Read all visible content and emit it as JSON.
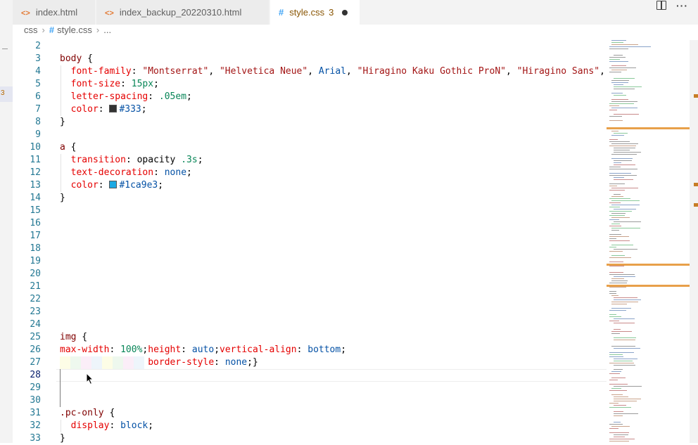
{
  "tabs": [
    {
      "icon": "<>",
      "label": "index.html"
    },
    {
      "icon": "<>",
      "label": "index_backup_20220310.html"
    },
    {
      "icon": "#",
      "label": "style.css",
      "problems": "3"
    }
  ],
  "tab_actions": {
    "more": "···"
  },
  "breadcrumb": {
    "folder": "css",
    "file": "style.css",
    "more": "..."
  },
  "activity_badge": "3",
  "lines": [
    {
      "n": "2"
    },
    {
      "n": "3",
      "tokens": [
        {
          "t": "body",
          "c": "sel"
        },
        {
          "t": " {",
          "c": ""
        }
      ]
    },
    {
      "n": "4",
      "tokens": [
        {
          "t": "  ",
          "c": ""
        },
        {
          "t": "font-family",
          "c": "prop"
        },
        {
          "t": ": ",
          "c": ""
        },
        {
          "t": "\"Montserrat\"",
          "c": "str"
        },
        {
          "t": ", ",
          "c": ""
        },
        {
          "t": "\"Helvetica Neue\"",
          "c": "str"
        },
        {
          "t": ", ",
          "c": ""
        },
        {
          "t": "Arial",
          "c": "val"
        },
        {
          "t": ", ",
          "c": ""
        },
        {
          "t": "\"Hiragino Kaku Gothic ProN\"",
          "c": "str"
        },
        {
          "t": ", ",
          "c": ""
        },
        {
          "t": "\"Hiragino Sans\"",
          "c": "str"
        },
        {
          "t": ", Meiryo,",
          "c": ""
        }
      ]
    },
    {
      "n": "5",
      "tokens": [
        {
          "t": "  ",
          "c": ""
        },
        {
          "t": "font-size",
          "c": "prop"
        },
        {
          "t": ": ",
          "c": ""
        },
        {
          "t": "15px",
          "c": "num"
        },
        {
          "t": ";",
          "c": ""
        }
      ]
    },
    {
      "n": "6",
      "tokens": [
        {
          "t": "  ",
          "c": ""
        },
        {
          "t": "letter-spacing",
          "c": "prop"
        },
        {
          "t": ": ",
          "c": ""
        },
        {
          "t": ".05em",
          "c": "num"
        },
        {
          "t": ";",
          "c": ""
        }
      ]
    },
    {
      "n": "7",
      "tokens": [
        {
          "t": "  ",
          "c": ""
        },
        {
          "t": "color",
          "c": "prop"
        },
        {
          "t": ": ",
          "c": ""
        },
        {
          "t": "",
          "c": "",
          "swatch": "#333333"
        },
        {
          "t": "#333",
          "c": "val"
        },
        {
          "t": ";",
          "c": ""
        }
      ]
    },
    {
      "n": "8",
      "tokens": [
        {
          "t": "}",
          "c": ""
        }
      ]
    },
    {
      "n": "9"
    },
    {
      "n": "10",
      "tokens": [
        {
          "t": "a",
          "c": "sel"
        },
        {
          "t": " {",
          "c": ""
        }
      ]
    },
    {
      "n": "11",
      "tokens": [
        {
          "t": "  ",
          "c": ""
        },
        {
          "t": "transition",
          "c": "prop"
        },
        {
          "t": ": opacity ",
          "c": ""
        },
        {
          "t": ".3s",
          "c": "num"
        },
        {
          "t": ";",
          "c": ""
        }
      ]
    },
    {
      "n": "12",
      "tokens": [
        {
          "t": "  ",
          "c": ""
        },
        {
          "t": "text-decoration",
          "c": "prop"
        },
        {
          "t": ": ",
          "c": ""
        },
        {
          "t": "none",
          "c": "val"
        },
        {
          "t": ";",
          "c": ""
        }
      ]
    },
    {
      "n": "13",
      "tokens": [
        {
          "t": "  ",
          "c": ""
        },
        {
          "t": "color",
          "c": "prop"
        },
        {
          "t": ": ",
          "c": ""
        },
        {
          "t": "",
          "c": "",
          "swatch": "#1ca9e3"
        },
        {
          "t": "#1ca9e3",
          "c": "val"
        },
        {
          "t": ";",
          "c": ""
        }
      ]
    },
    {
      "n": "14",
      "tokens": [
        {
          "t": "}",
          "c": ""
        }
      ]
    },
    {
      "n": "15"
    },
    {
      "n": "16"
    },
    {
      "n": "17"
    },
    {
      "n": "18"
    },
    {
      "n": "19"
    },
    {
      "n": "20"
    },
    {
      "n": "21"
    },
    {
      "n": "22"
    },
    {
      "n": "23"
    },
    {
      "n": "24"
    },
    {
      "n": "25",
      "tokens": [
        {
          "t": "img",
          "c": "sel"
        },
        {
          "t": " {",
          "c": ""
        }
      ]
    },
    {
      "n": "26",
      "tokens": [
        {
          "t": "max-width",
          "c": "prop"
        },
        {
          "t": ": ",
          "c": ""
        },
        {
          "t": "100%",
          "c": "num"
        },
        {
          "t": ";",
          "c": ""
        },
        {
          "t": "height",
          "c": "prop"
        },
        {
          "t": ": ",
          "c": ""
        },
        {
          "t": "auto",
          "c": "val"
        },
        {
          "t": ";",
          "c": ""
        },
        {
          "t": "vertical-align",
          "c": "prop"
        },
        {
          "t": ": ",
          "c": ""
        },
        {
          "t": "bottom",
          "c": "val"
        },
        {
          "t": ";",
          "c": ""
        }
      ]
    },
    {
      "n": "27",
      "tokens": [
        {
          "t": "                ",
          "c": ""
        },
        {
          "t": "border-style",
          "c": "prop"
        },
        {
          "t": ": ",
          "c": ""
        },
        {
          "t": "none",
          "c": "val"
        },
        {
          "t": ";}",
          "c": ""
        }
      ]
    },
    {
      "n": "28",
      "current": true
    },
    {
      "n": "29"
    },
    {
      "n": "30"
    },
    {
      "n": "31",
      "tokens": [
        {
          "t": ".pc-only",
          "c": "sel"
        },
        {
          "t": " {",
          "c": ""
        }
      ]
    },
    {
      "n": "32",
      "tokens": [
        {
          "t": "  ",
          "c": ""
        },
        {
          "t": "display",
          "c": "prop"
        },
        {
          "t": ": ",
          "c": ""
        },
        {
          "t": "block",
          "c": "val"
        },
        {
          "t": ";",
          "c": ""
        }
      ]
    },
    {
      "n": "33",
      "tokens": [
        {
          "t": "}",
          "c": ""
        }
      ]
    }
  ],
  "colors": {
    "selector": "#800000",
    "property": "#e50000",
    "string": "#a31515",
    "value": "#0451a5",
    "number": "#098658",
    "line_number": "#237893",
    "modified_tab": "#895503",
    "css_icon": "#42a5f5",
    "html_icon": "#e37933"
  }
}
